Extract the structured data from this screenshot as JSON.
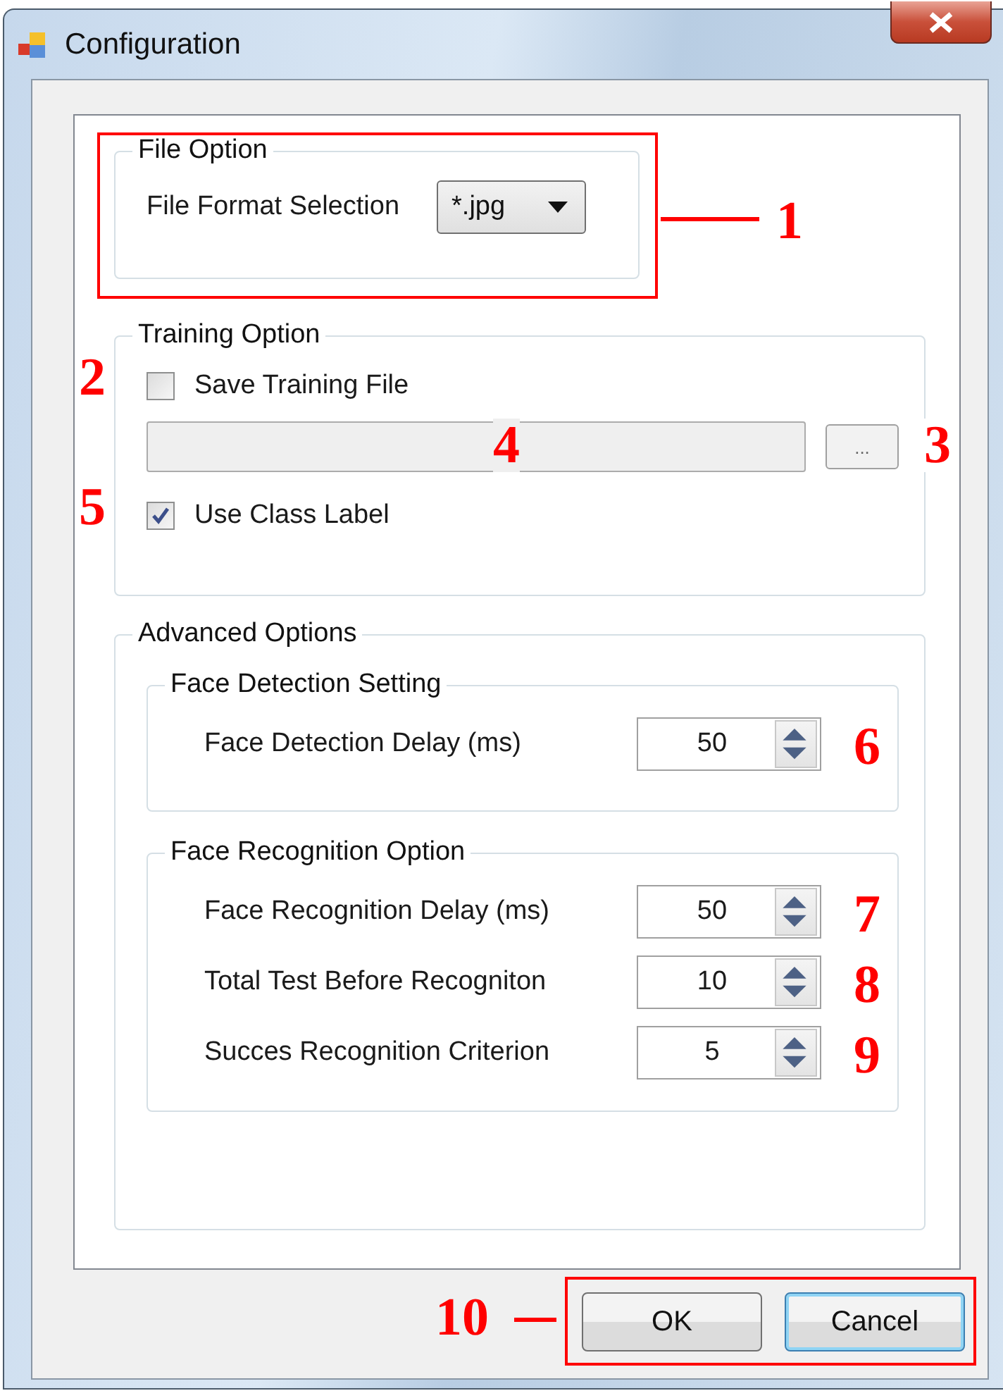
{
  "window": {
    "title": "Configuration"
  },
  "file_option": {
    "title": "File Option",
    "label": "File Format Selection",
    "format": "*.jpg",
    "callout": "1"
  },
  "training_option": {
    "title": "Training Option",
    "save_training_file": {
      "label": "Save Training File",
      "checked": false,
      "callout": "2"
    },
    "path_field": {
      "callout": "4"
    },
    "browse_button": {
      "label": "...",
      "callout": "3"
    },
    "use_class_label": {
      "label": "Use Class Label",
      "checked": true,
      "callout": "5"
    }
  },
  "advanced_options": {
    "title": "Advanced Options",
    "groups": [
      {
        "title": "Face Detection Setting",
        "fields": [
          {
            "label": "Face Detection Delay  (ms)",
            "value": "50",
            "callout": "6"
          }
        ]
      },
      {
        "title": "Face Recognition Option",
        "fields": [
          {
            "label": "Face Recognition Delay  (ms)",
            "value": "50",
            "callout": "7"
          },
          {
            "label": "Total Test Before Recogniton",
            "value": "10",
            "callout": "8"
          },
          {
            "label": "Succes Recognition  Criterion",
            "value": "5",
            "callout": "9"
          }
        ]
      }
    ]
  },
  "buttons": [
    {
      "label": "OK",
      "focused": false
    },
    {
      "label": "Cancel",
      "focused": true
    }
  ],
  "buttons_callout": "10"
}
